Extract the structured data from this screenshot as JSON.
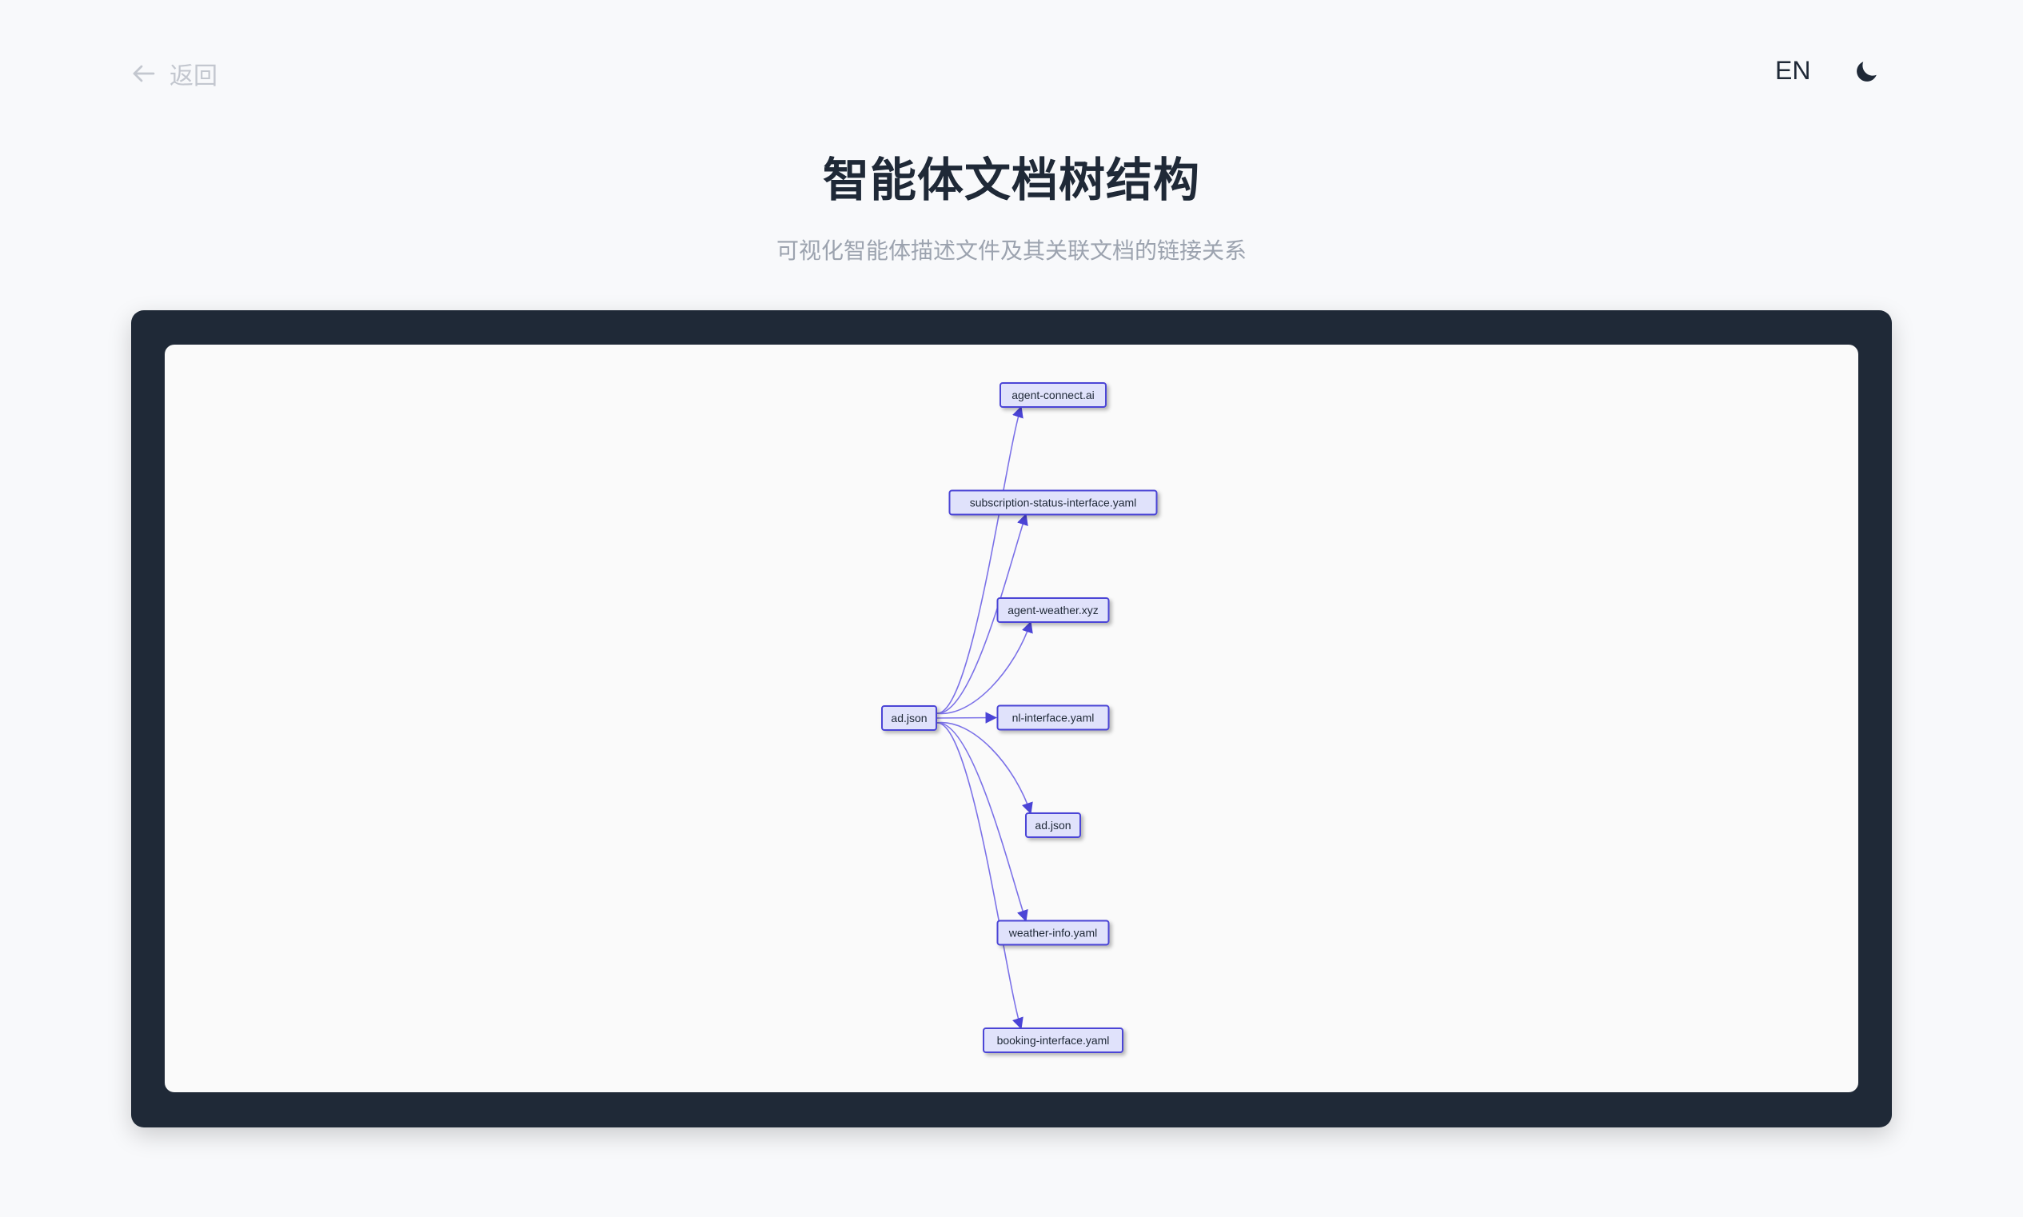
{
  "header": {
    "back_label": "返回",
    "lang_label": "EN",
    "theme_icon": "moon-icon"
  },
  "page": {
    "title": "智能体文档树结构",
    "subtitle": "可视化智能体描述文件及其关联文档的链接关系"
  },
  "tree": {
    "root": "ad.json",
    "children": [
      "agent-connect.ai",
      "subscription-status-interface.yaml",
      "agent-weather.xyz",
      "nl-interface.yaml",
      "ad.json",
      "weather-info.yaml",
      "booking-interface.yaml"
    ]
  },
  "colors": {
    "node_fill": "#e0e2fb",
    "node_stroke": "#4b44d6",
    "edge": "#7c72e8",
    "frame": "#1f2937"
  }
}
